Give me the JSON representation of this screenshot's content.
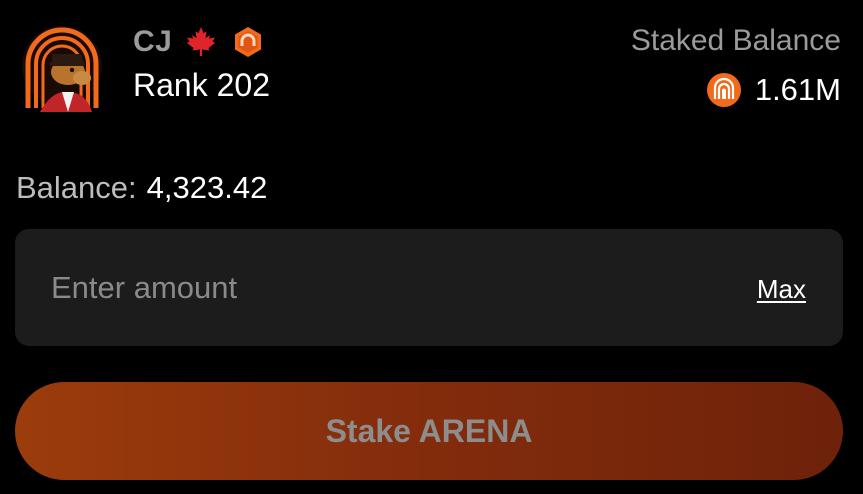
{
  "profile": {
    "name": "CJ",
    "rank": "Rank 202",
    "avatar": "camel-avatar",
    "flag_icon": "maple-leaf-icon",
    "badge_icon": "rank-badge-icon"
  },
  "staked": {
    "label": "Staked Balance",
    "value": "1.61M",
    "token_icon": "arena-token-icon"
  },
  "balance": {
    "label": "Balance:",
    "value": "4,323.42"
  },
  "amount_input": {
    "placeholder": "Enter amount",
    "value": "",
    "max_label": "Max"
  },
  "stake_button": {
    "label": "Stake ARENA"
  },
  "colors": {
    "background": "#000000",
    "card": "#1c1c1c",
    "accent": "#f26a1b",
    "button_gradient_start": "#9b3c0c",
    "button_gradient_end": "#6e220a",
    "muted_text": "#9b9b9b"
  }
}
